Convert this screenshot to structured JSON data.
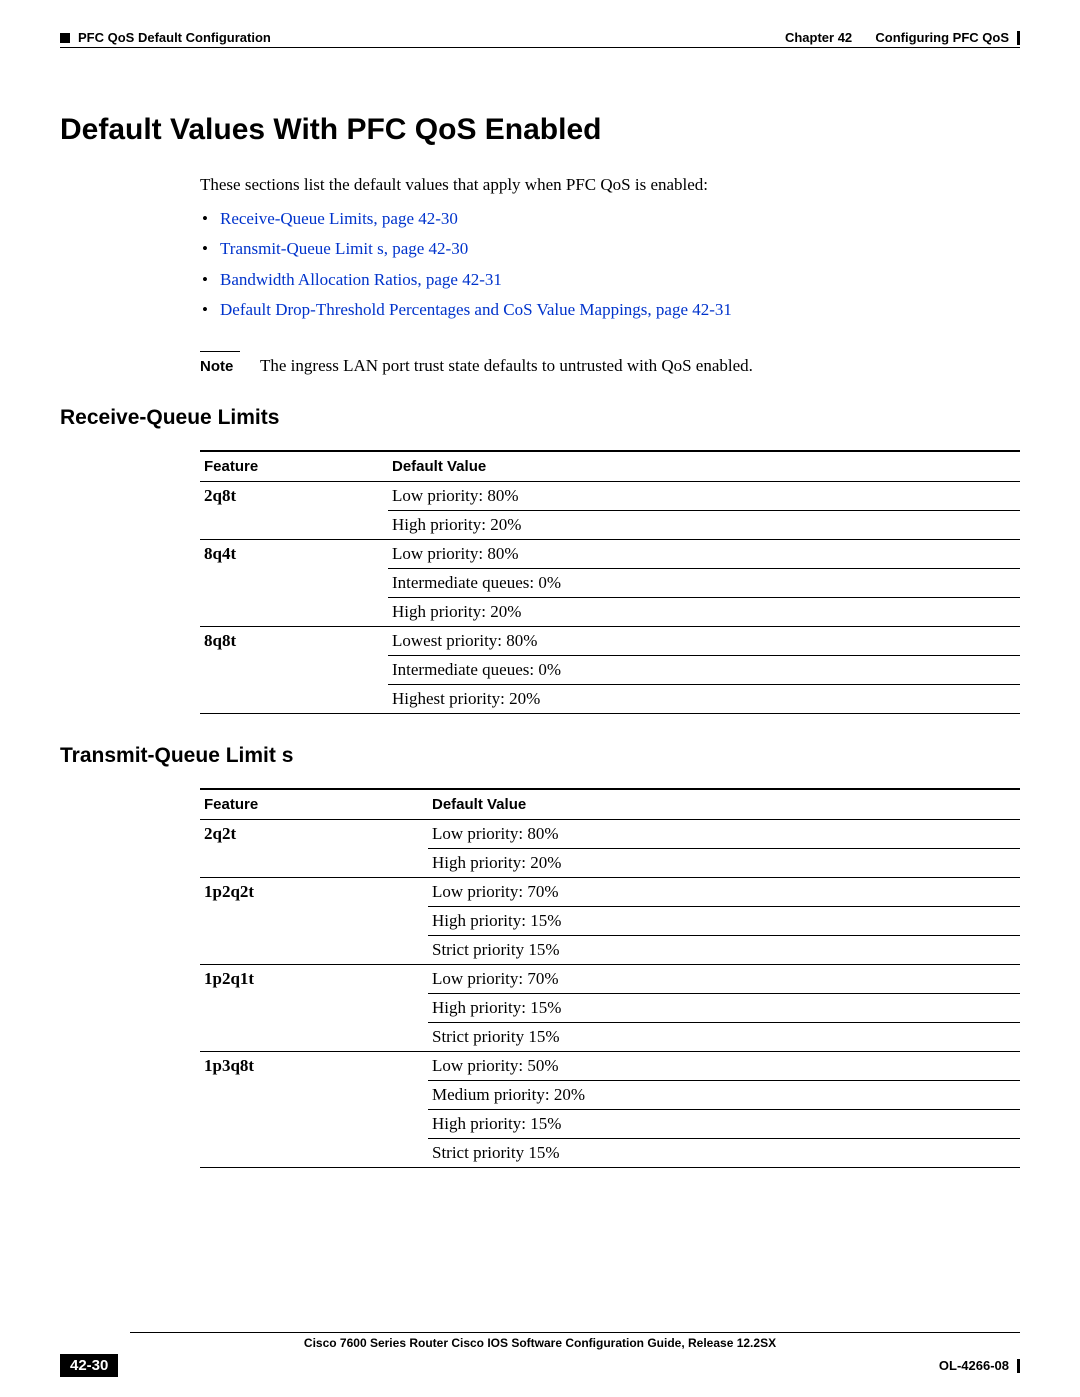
{
  "header": {
    "left_section": "PFC QoS Default Configuration",
    "right_chapter": "Chapter 42",
    "right_title": "Configuring PFC QoS"
  },
  "title": "Default Values With PFC QoS Enabled",
  "intro": "These sections list the default values that apply when PFC QoS is enabled:",
  "links": [
    "Receive-Queue Limits, page 42-30",
    "Transmit-Queue Limit s, page 42-30",
    "Bandwidth Allocation Ratios, page 42-31",
    "Default Drop-Threshold Percentages and CoS Value Mappings, page 42-31"
  ],
  "note": {
    "label": "Note",
    "text": "The ingress LAN port trust state defaults to untrusted with QoS enabled."
  },
  "rx": {
    "heading": "Receive-Queue Limits",
    "col_feature": "Feature",
    "col_value": "Default Value",
    "rows": [
      {
        "feature": "2q8t",
        "values": [
          "Low priority: 80%",
          "High priority: 20%"
        ]
      },
      {
        "feature": "8q4t",
        "values": [
          "Low priority: 80%",
          "Intermediate queues: 0%",
          "High priority: 20%"
        ]
      },
      {
        "feature": "8q8t",
        "values": [
          "Lowest priority: 80%",
          "Intermediate queues: 0%",
          "Highest priority: 20%"
        ]
      }
    ]
  },
  "tx": {
    "heading": "Transmit-Queue Limit s",
    "col_feature": "Feature",
    "col_value": "Default Value",
    "rows": [
      {
        "feature": "2q2t",
        "values": [
          "Low priority: 80%",
          "High priority: 20%"
        ]
      },
      {
        "feature": "1p2q2t",
        "values": [
          "Low priority: 70%",
          "High priority: 15%",
          "Strict priority 15%"
        ]
      },
      {
        "feature": "1p2q1t",
        "values": [
          "Low priority: 70%",
          "High priority: 15%",
          "Strict priority 15%"
        ]
      },
      {
        "feature": "1p3q8t",
        "values": [
          "Low priority: 50%",
          "Medium priority: 20%",
          "High priority: 15%",
          "Strict priority 15%"
        ]
      }
    ]
  },
  "footer": {
    "book": "Cisco 7600 Series Router Cisco IOS Software Configuration Guide, Release 12.2SX",
    "page": "42-30",
    "docid": "OL-4266-08"
  }
}
